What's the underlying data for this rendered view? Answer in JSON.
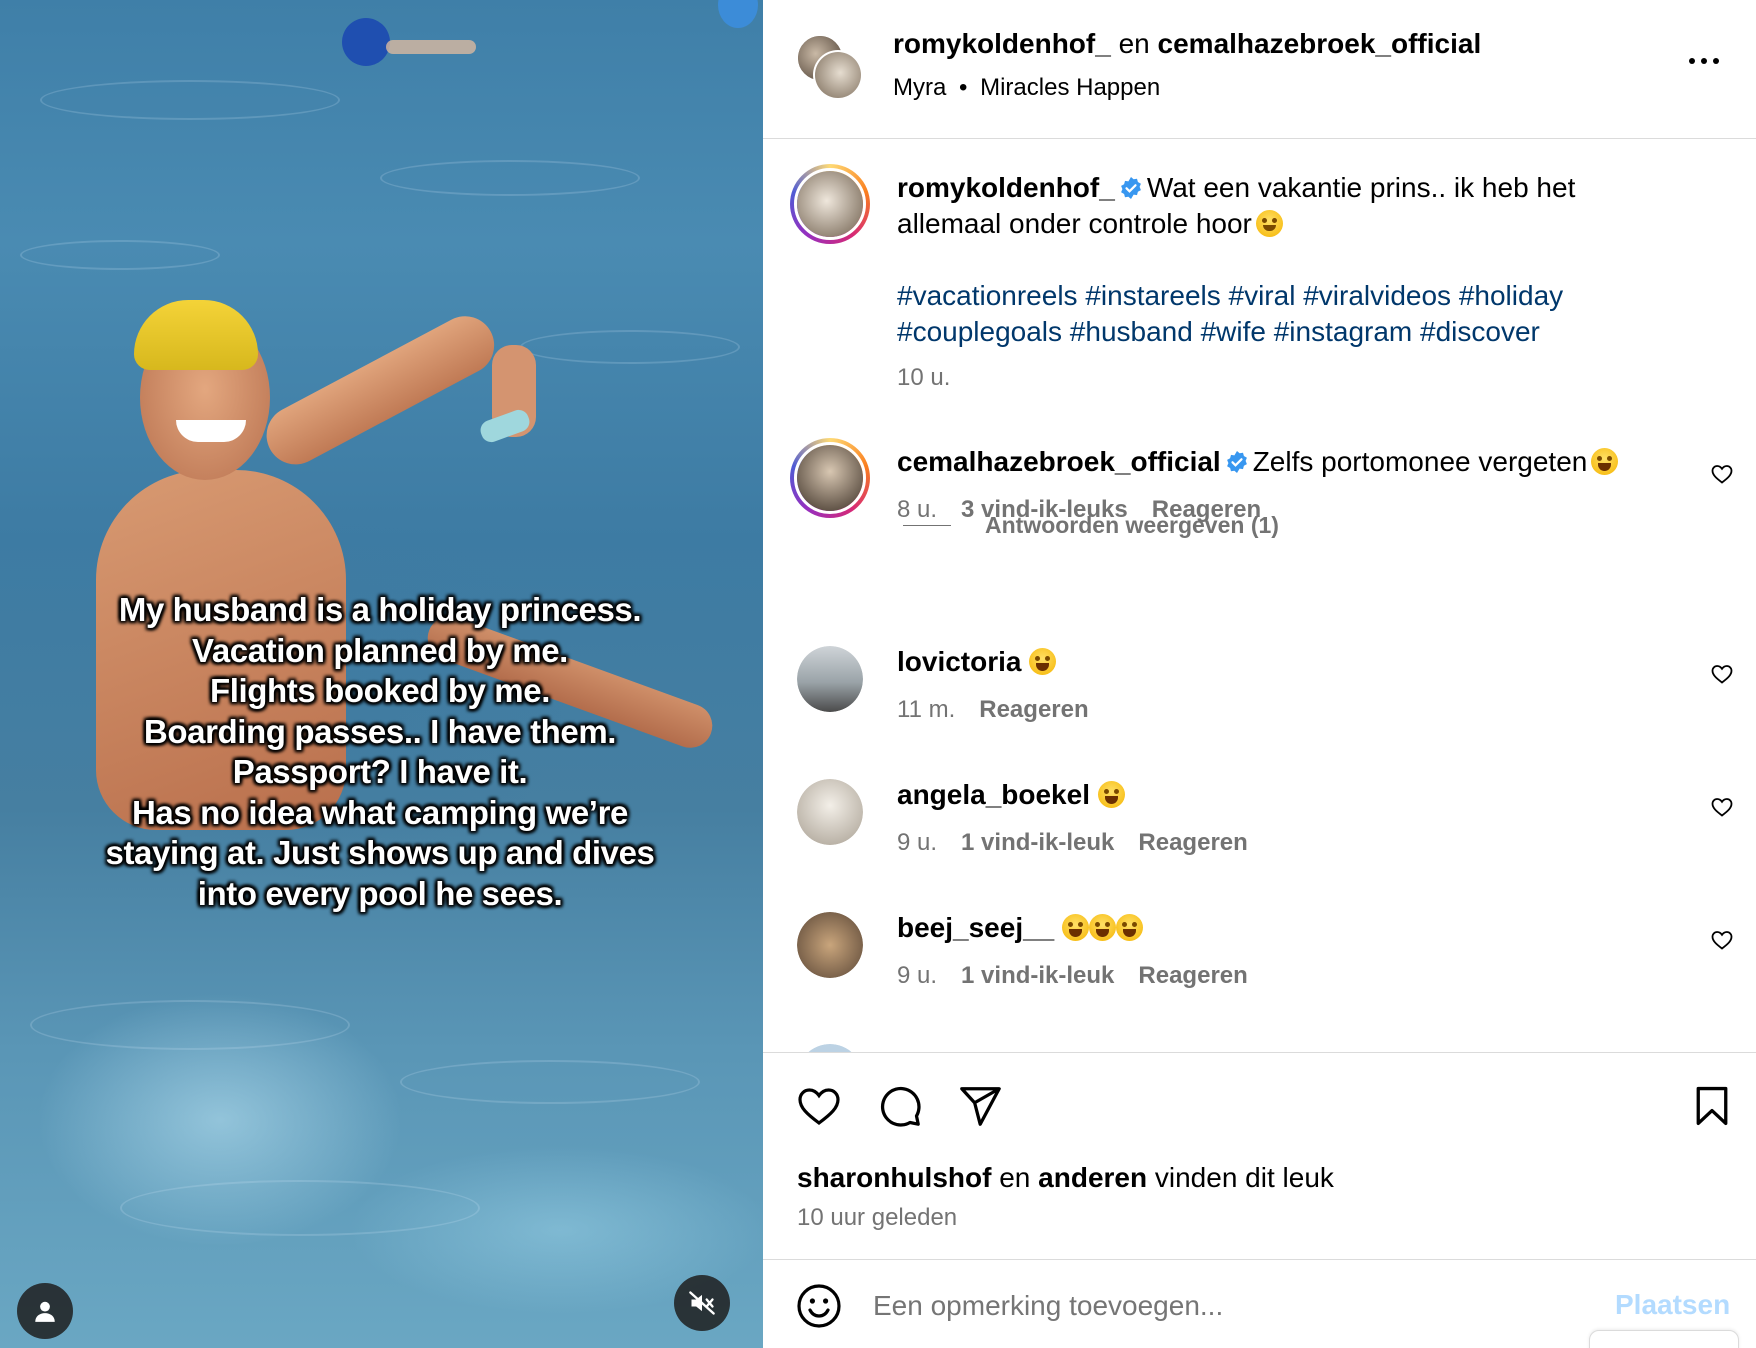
{
  "media": {
    "overlay_lines": [
      "My husband is a holiday princess.",
      "Vacation planned by me.",
      "Flights booked by me.",
      "Boarding passes.. I have them.",
      "Passport? I have it.",
      "Has no idea what camping we’re",
      "staying at. Just shows up and dives",
      "into every pool he sees."
    ],
    "user_icon": "user-icon",
    "mute_icon": "muted-speaker-icon"
  },
  "header": {
    "user1": "romykoldenhof_",
    "joiner": "en",
    "user2": "cemalhazebroek_official",
    "music_artist": "Myra",
    "separator": "•",
    "music_title": "Miracles Happen",
    "more_icon": "more-options-icon"
  },
  "caption": {
    "username": "romykoldenhof_",
    "text_line1": "Wat een vakantie prins.. ik heb het",
    "text_line2": "allemaal onder controle hoor",
    "hashtags_line1": "#vacationreels #instareels #viral #viralvideos #holiday",
    "hashtags_line2": "#couplegoals #husband #wife #instagram #discover",
    "time": "10 u."
  },
  "comments": [
    {
      "username": "cemalhazebroek_official",
      "text": "Zelfs portomonee vergeten",
      "time": "8 u.",
      "likes": "3 vind-ik-leuks",
      "reply": "Reageren",
      "view_replies": "Antwoorden weergeven (1)"
    },
    {
      "username": "lovictoria",
      "text": "",
      "time": "11 m.",
      "likes": "",
      "reply": "Reageren"
    },
    {
      "username": "angela_boekel",
      "text": "",
      "time": "9 u.",
      "likes": "1 vind-ik-leuk",
      "reply": "Reageren"
    },
    {
      "username": "beej_seej__",
      "text": "",
      "time": "9 u.",
      "likes": "1 vind-ik-leuk",
      "reply": "Reageren"
    }
  ],
  "actions": {
    "liked_by_user": "sharonhulshof",
    "liked_by_mid": "en",
    "liked_by_others": "anderen",
    "liked_by_suffix": "vinden dit leuk",
    "time_ago": "10 uur geleden"
  },
  "add_comment": {
    "placeholder": "Een opmerking toevoegen...",
    "post_label": "Plaatsen"
  },
  "colors": {
    "verified": "#3897f0",
    "link": "#00376b",
    "muted": "#737373",
    "post_disabled": "#b3dbff"
  }
}
